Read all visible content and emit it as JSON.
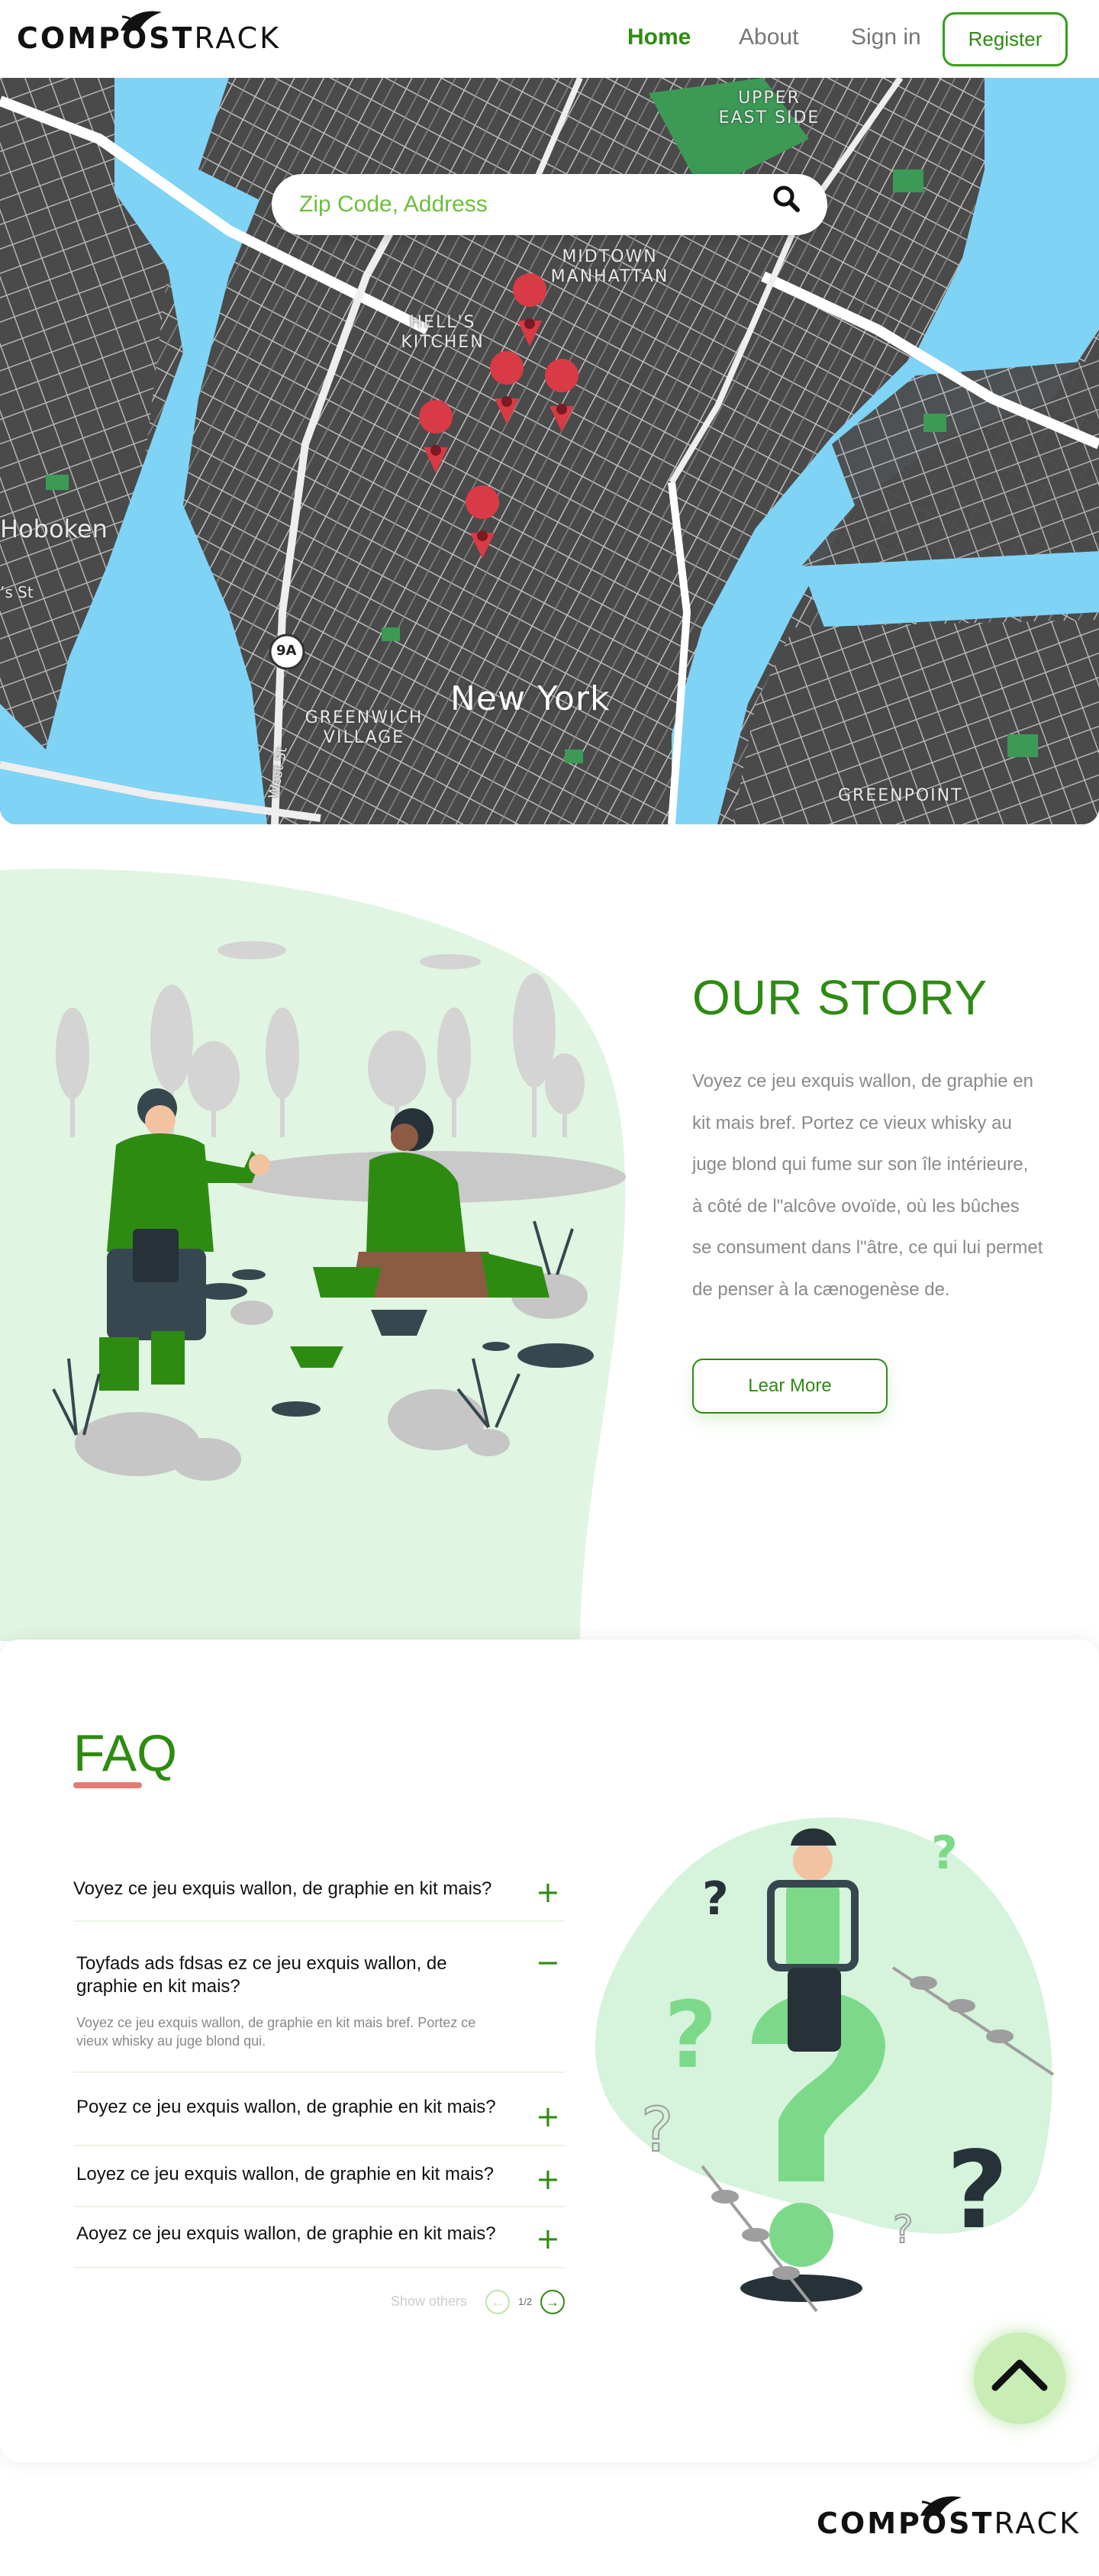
{
  "header": {
    "logo_bold": "COMPOST",
    "logo_light": "RACK",
    "nav": {
      "home": "Home",
      "about": "About",
      "signin": "Sign in"
    },
    "register": "Register"
  },
  "map": {
    "search_placeholder": "Zip Code, Address",
    "labels": {
      "upper_east_side": "UPPER EAST SIDE",
      "midtown": "MIDTOWN MANHATTAN",
      "hells_kitchen": "HELL'S KITCHEN",
      "hoboken": "Hoboken",
      "new_york": "New York",
      "greenwich": "GREENWICH VILLAGE",
      "greenpoint": "GREENPOINT",
      "route": "9A",
      "west_st": "West St",
      "st": "ʼs St"
    },
    "colors": {
      "water": "#7fd3f5",
      "land": "#4a4a4a",
      "park": "#3c9a56",
      "pin": "#d83a46"
    }
  },
  "story": {
    "title": "OUR STORY",
    "text": "Voyez ce jeu exquis wallon, de graphie en kit mais bref. Portez ce vieux whisky au juge blond qui fume sur son île intérieure, à côté de l\"alcôve ovoïde, où les bûches se consument dans l\"âtre, ce qui lui permet de penser à la cænogenèse de.",
    "button": "Lear More"
  },
  "faq": {
    "title": "FAQ",
    "items": [
      {
        "question": "Voyez ce jeu exquis wallon, de graphie en kit mais?",
        "toggle": "+"
      },
      {
        "question": "Toyfads ads fdsas ez ce jeu exquis wallon, de graphie en kit mais?",
        "toggle": "−",
        "answer": "Voyez ce jeu exquis wallon, de graphie en kit mais bref. Portez ce vieux whisky au juge blond qui."
      },
      {
        "question": "Poyez ce jeu exquis wallon, de graphie en kit mais?",
        "toggle": "+"
      },
      {
        "question": "Loyez ce jeu exquis wallon, de graphie en kit mais?",
        "toggle": "+"
      },
      {
        "question": "Aoyez ce jeu exquis wallon, de graphie en kit mais?",
        "toggle": "+"
      }
    ],
    "show_others": "Show others",
    "page_indicator": "1/2",
    "prev": "←",
    "next": "→"
  },
  "footer": {
    "logo_bold": "COMPOST",
    "logo_light": "RACK"
  },
  "theme": {
    "accent": "#2e8b12",
    "accent_light": "#c8edb5",
    "underline": "#e77b74"
  }
}
